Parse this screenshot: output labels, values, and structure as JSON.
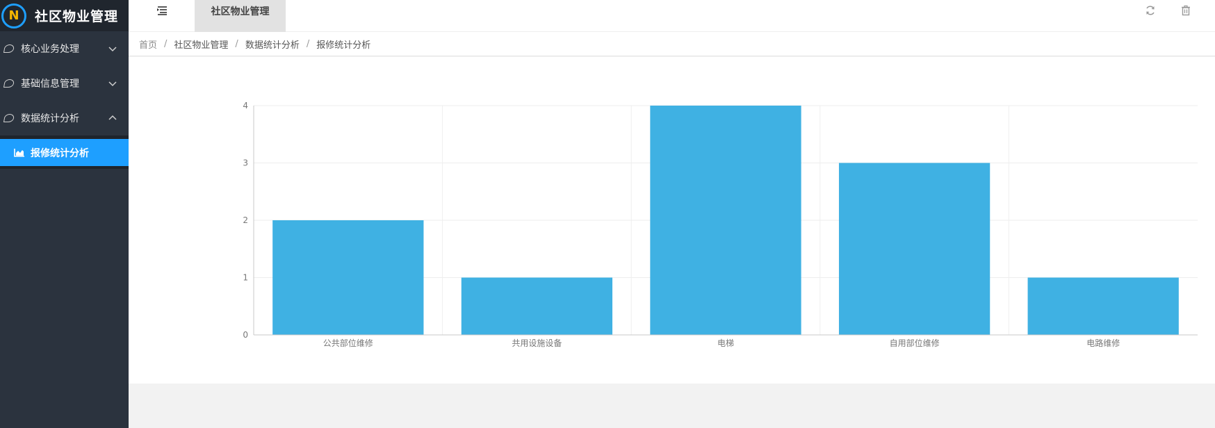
{
  "app": {
    "title": "社区物业管理"
  },
  "sidebar": {
    "items": [
      {
        "label": "核心业务处理",
        "expanded": false
      },
      {
        "label": "基础信息管理",
        "expanded": false
      },
      {
        "label": "数据统计分析",
        "expanded": true
      }
    ],
    "subitems": [
      {
        "label": "报修统计分析",
        "active": true
      }
    ]
  },
  "topbar": {
    "tab_label": "社区物业管理",
    "icons": [
      "menu-toggle-icon",
      "refresh-icon",
      "trash-icon"
    ]
  },
  "breadcrumb": [
    "首页",
    "社区物业管理",
    "数据统计分析",
    "报修统计分析"
  ],
  "colors": {
    "sidebar_bg": "#2b333e",
    "accent": "#1e9fff",
    "bar": "#3fb1e3"
  },
  "chart_data": {
    "type": "bar",
    "categories": [
      "公共部位维修",
      "共用设施设备",
      "电梯",
      "自用部位维修",
      "电路维修"
    ],
    "values": [
      2,
      1,
      4,
      3,
      1
    ],
    "ylim": [
      0,
      4
    ],
    "yticks": [
      0,
      1,
      2,
      3,
      4
    ],
    "grid": true
  }
}
